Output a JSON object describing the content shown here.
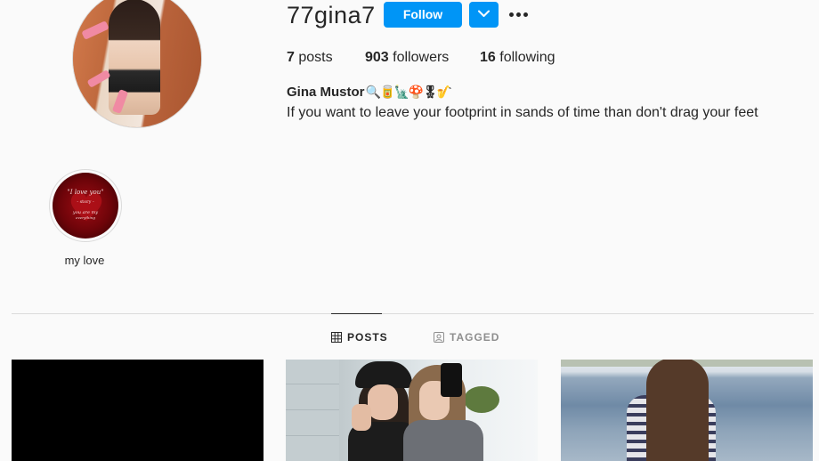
{
  "profile": {
    "username": "77gina7",
    "follow_label": "Follow",
    "stats": {
      "posts_count": "7",
      "posts_label": "posts",
      "followers_count": "903",
      "followers_label": "followers",
      "following_count": "16",
      "following_label": "following"
    },
    "full_name": "Gina Mustor",
    "name_emojis": [
      "🔍",
      "🥫",
      "🗽",
      "🍄",
      "🎖",
      "🎷"
    ],
    "bio": "If you want to leave your footprint in sands of time than don't drag your feet"
  },
  "highlights": [
    {
      "label": "my love",
      "cover_text": [
        "\"I love you\"",
        "- story -",
        "you are my",
        "everything"
      ]
    }
  ],
  "tabs": [
    {
      "label": "POSTS",
      "active": true,
      "icon": "grid-icon"
    },
    {
      "label": "TAGGED",
      "active": false,
      "icon": "tagged-icon"
    }
  ],
  "colors": {
    "accent": "#0095f6",
    "background": "#fafafa",
    "text": "#262626",
    "muted": "#8e8e8e",
    "divider": "#dbdbdb"
  }
}
